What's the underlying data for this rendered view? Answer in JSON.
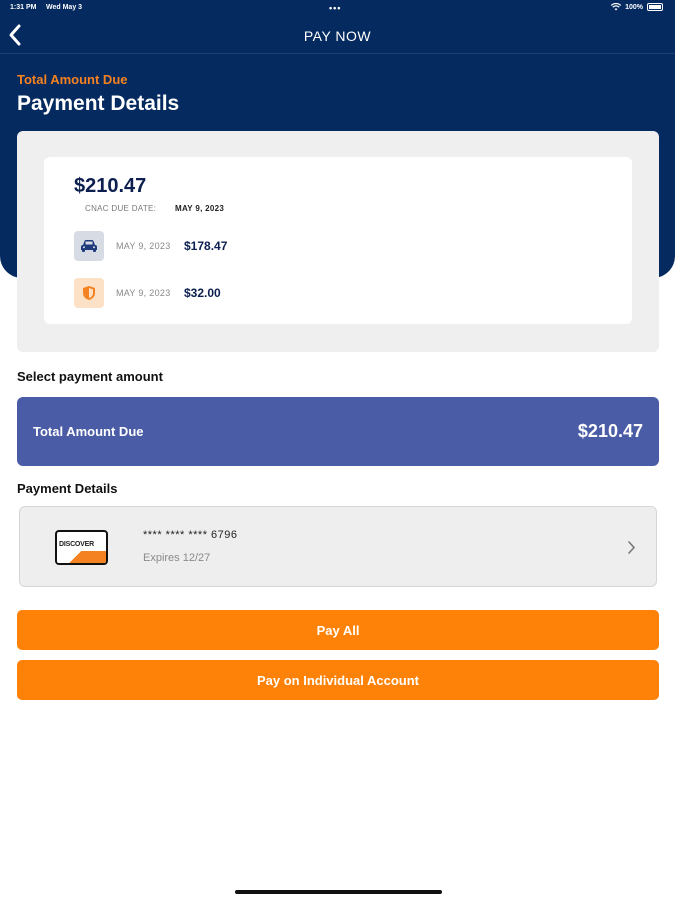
{
  "status_bar": {
    "time": "1:31 PM",
    "date": "Wed May 3",
    "dots": "•••",
    "battery": "100%"
  },
  "nav": {
    "title": "PAY NOW"
  },
  "header": {
    "kicker": "Total Amount Due",
    "title": "Payment Details"
  },
  "summary": {
    "total": "$210.47",
    "due_label": "CNAC DUE DATE:",
    "due_value": "MAY 9, 2023",
    "accounts": [
      {
        "icon": "car-icon",
        "date": "MAY 9, 2023",
        "amount": "$178.47"
      },
      {
        "icon": "shield-icon",
        "date": "MAY 9, 2023",
        "amount": "$32.00"
      }
    ]
  },
  "payment_amount": {
    "section_label": "Select payment amount",
    "option_label": "Total Amount Due",
    "option_value": "$210.47"
  },
  "payment_details": {
    "section_label": "Payment Details",
    "card_brand": "DISCOVER",
    "card_number": "**** **** **** 6796",
    "card_expiry": "Expires 12/27"
  },
  "buttons": {
    "pay_all": "Pay All",
    "pay_individual": "Pay on Individual Account"
  },
  "colors": {
    "navy": "#052a5f",
    "orange": "#ff8208",
    "accent_blue": "#4a5ca6",
    "kicker_orange": "#f58220"
  }
}
